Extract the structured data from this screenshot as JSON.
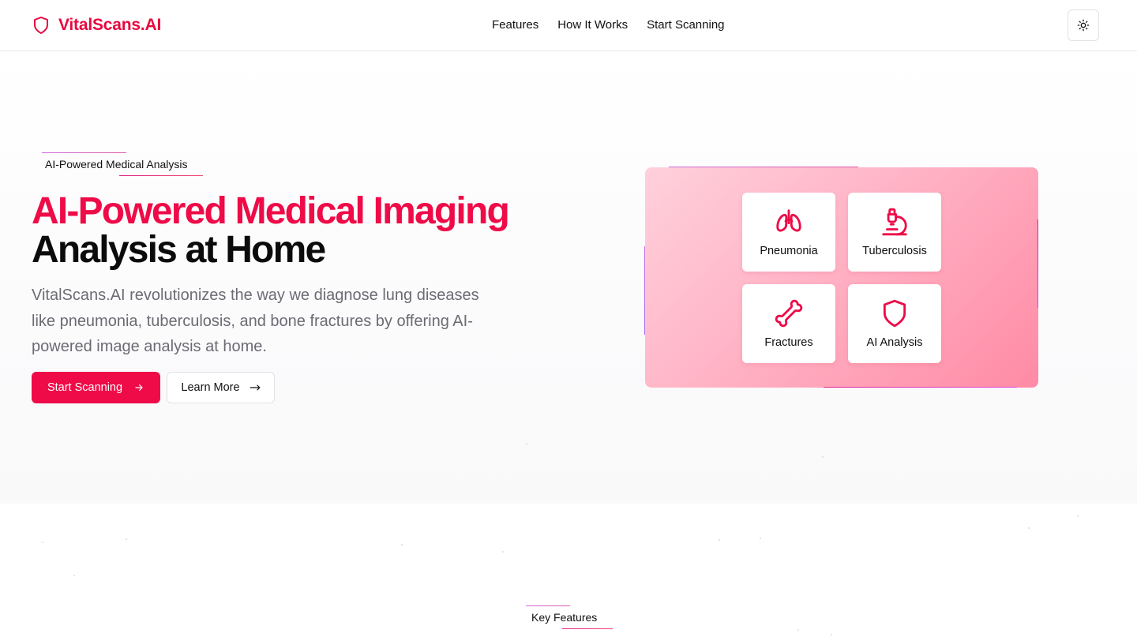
{
  "brand": {
    "name": "VitalScans.AI",
    "accent_color": "#ee0b47",
    "logo_icon": "shield-icon"
  },
  "nav": {
    "items": [
      {
        "label": "Features"
      },
      {
        "label": "How It Works"
      },
      {
        "label": "Start Scanning"
      }
    ],
    "theme_toggle_icon": "sun-icon"
  },
  "hero": {
    "badge": "AI-Powered Medical Analysis",
    "headline_line1": "AI-Powered Medical Imaging",
    "headline_line2": "Analysis at Home",
    "description": "VitalScans.AI revolutionizes the way we diagnose lung diseases like pneumonia, tuberculosis, and bone fractures by offering AI-powered image analysis at home.",
    "primary_button": "Start Scanning",
    "secondary_button": "Learn More"
  },
  "cards": [
    {
      "label": "Pneumonia",
      "icon": "lungs-icon"
    },
    {
      "label": "Tuberculosis",
      "icon": "microscope-icon"
    },
    {
      "label": "Fractures",
      "icon": "bone-icon"
    },
    {
      "label": "AI Analysis",
      "icon": "shield-icon"
    }
  ],
  "features_section": {
    "badge": "Key Features"
  }
}
